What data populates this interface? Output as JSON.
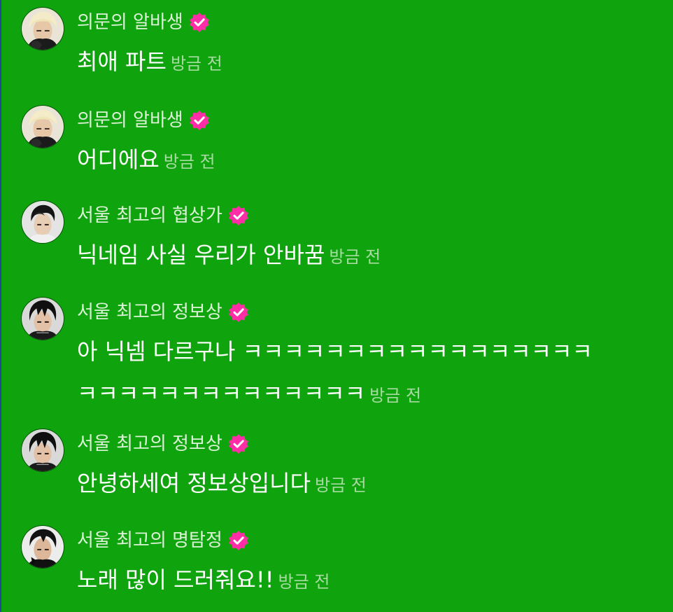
{
  "colors": {
    "background": "#0fa30d",
    "name_text": "#ddf3d8",
    "message_text": "#ffffff",
    "timestamp_text": "#a7dba1",
    "verified_badge": "#ff2ea6"
  },
  "messages": [
    {
      "name": "의문의 알바생",
      "text": "최애 파트",
      "time": "방금 전",
      "avatar": "blonde-avatar",
      "verified": "verified-badge-icon"
    },
    {
      "name": "의문의 알바생",
      "text": "어디에요",
      "time": "방금 전",
      "avatar": "blonde-avatar",
      "verified": "verified-badge-icon"
    },
    {
      "name": "서울 최고의 협상가",
      "text": "닉네임 사실 우리가 안바꿈",
      "time": "방금 전",
      "avatar": "dark-hair-avatar",
      "verified": "verified-badge-icon"
    },
    {
      "name": "서울 최고의 정보상",
      "text": "아 닉넴 다르구나 ㅋㅋㅋㅋㅋㅋㅋㅋㅋㅋㅋㅋㅋㅋㅋㅋㅋㅋㅋㅋㅋㅋㅋㅋㅋㅋㅋㅋㅋㅋㅋ",
      "time": "방금 전",
      "avatar": "black-hair-avatar",
      "verified": "verified-badge-icon"
    },
    {
      "name": "서울 최고의 정보상",
      "text": "안녕하세여 정보상입니다",
      "time": "방금 전",
      "avatar": "black-hair-avatar",
      "verified": "verified-badge-icon"
    },
    {
      "name": "서울 최고의 명탐정",
      "text": "노래 많이 드러줘요!!",
      "time": "방금 전",
      "avatar": "dark-hair-avatar-2",
      "verified": "verified-badge-icon"
    }
  ]
}
